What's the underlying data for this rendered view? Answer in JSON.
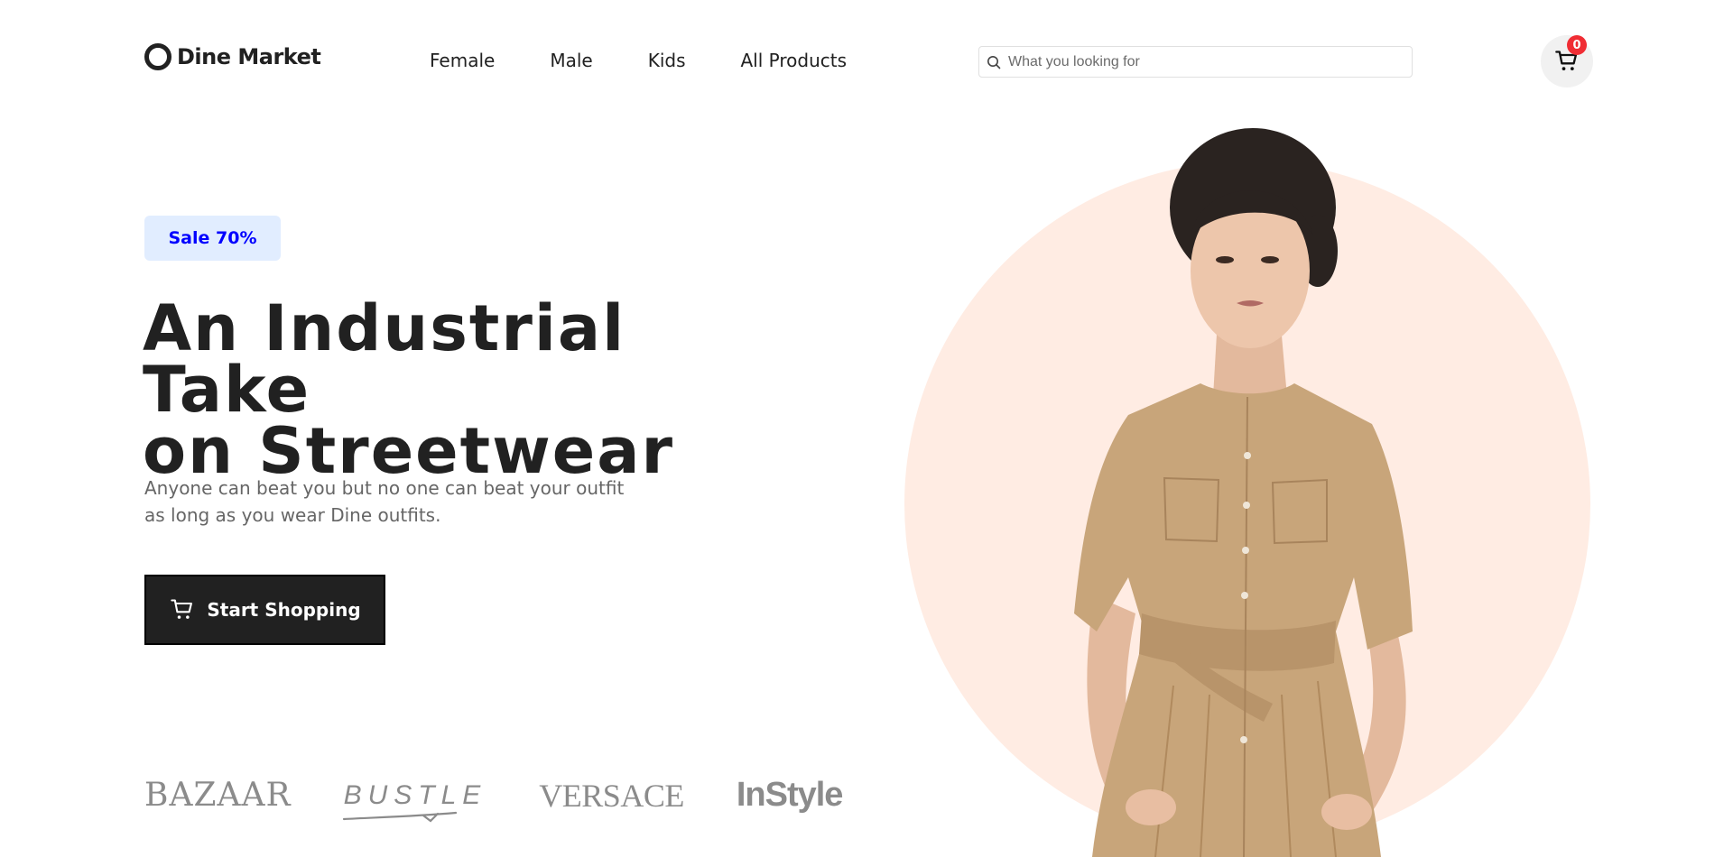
{
  "header": {
    "logo_text": "Dine Market",
    "nav": [
      "Female",
      "Male",
      "Kids",
      "All Products"
    ],
    "search_placeholder": "What you looking for",
    "cart_count": "0"
  },
  "hero": {
    "badge": "Sale 70%",
    "headline_line1": "An Industrial Take",
    "headline_line2": "on Streetwear",
    "subtext_line1": "Anyone can beat you but no one can beat your outfit",
    "subtext_line2": "as long as you wear Dine outfits.",
    "cta_label": "Start Shopping"
  },
  "brands": [
    "BAZAAR",
    "BUSTLE",
    "VERSACE",
    "InStyle"
  ],
  "colors": {
    "text": "#212121",
    "badge_bg": "#e1edff",
    "badge_text": "#0000ff",
    "circle": "#ffece3",
    "cart_badge": "#f02d34",
    "dress": "#c8a57a"
  }
}
